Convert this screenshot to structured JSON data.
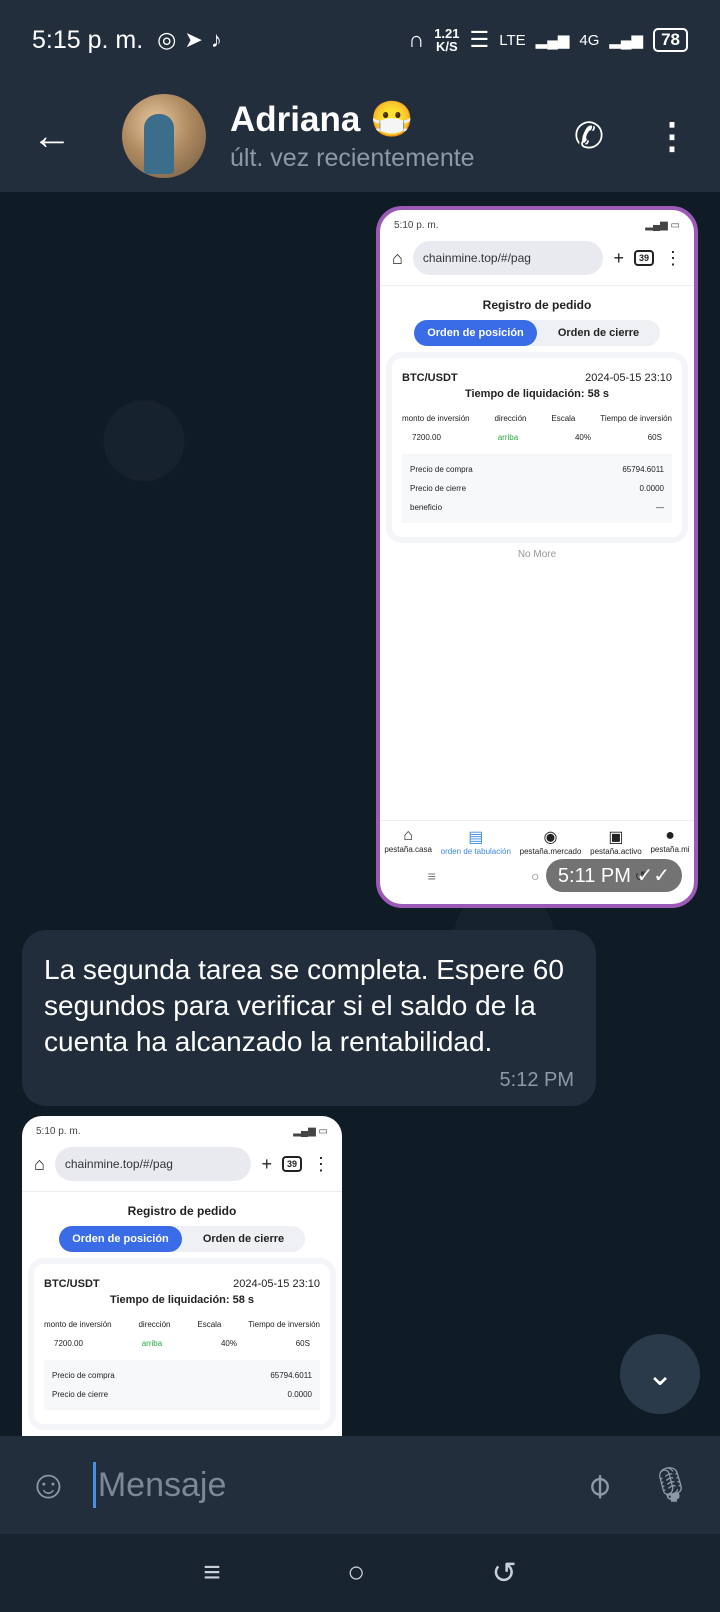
{
  "status_bar": {
    "time": "5:15 p. m.",
    "speed_value": "1.21",
    "speed_unit": "K/S",
    "network_1": "LTE",
    "network_2": "4G",
    "battery": "78"
  },
  "header": {
    "contact_name": "Adriana 😷",
    "last_seen": "últ. vez recientemente"
  },
  "messages": {
    "image_1": {
      "time": "5:11 PM ✓✓",
      "status_time": "5:10 p. m.",
      "url": "chainmine.top/#/pag",
      "tabs_count": "39",
      "title": "Registro de pedido",
      "tab_open": "Orden de posición",
      "tab_close": "Orden de cierre",
      "pair": "BTC/USDT",
      "date": "2024-05-15 23:10",
      "liquidation": "Tiempo de liquidación: 58 s",
      "col_amount": "monto de inversión",
      "col_direction": "dirección",
      "col_scale": "Escala",
      "col_time": "Tiempo de inversión",
      "val_amount": "7200.00",
      "val_direction": "arriba",
      "val_scale": "40%",
      "val_time": "60S",
      "buy_label": "Precio de compra",
      "buy_value": "65794.6011",
      "close_label": "Precio de cierre",
      "close_value": "0.0000",
      "profit_label": "beneficio",
      "profit_value": "—",
      "no_more": "No More",
      "nav_home": "pestaña.casa",
      "nav_orders": "orden de tabulación",
      "nav_market": "pestaña.mercado",
      "nav_assets": "pestaña.activo",
      "nav_me": "pestaña.mi"
    },
    "text_1": {
      "text": "La segunda tarea se completa. Espere 60 segundos para verificar si el saldo de la cuenta ha alcanzado la rentabilidad.",
      "time": "5:12 PM"
    }
  },
  "input": {
    "placeholder": "Mensaje"
  }
}
